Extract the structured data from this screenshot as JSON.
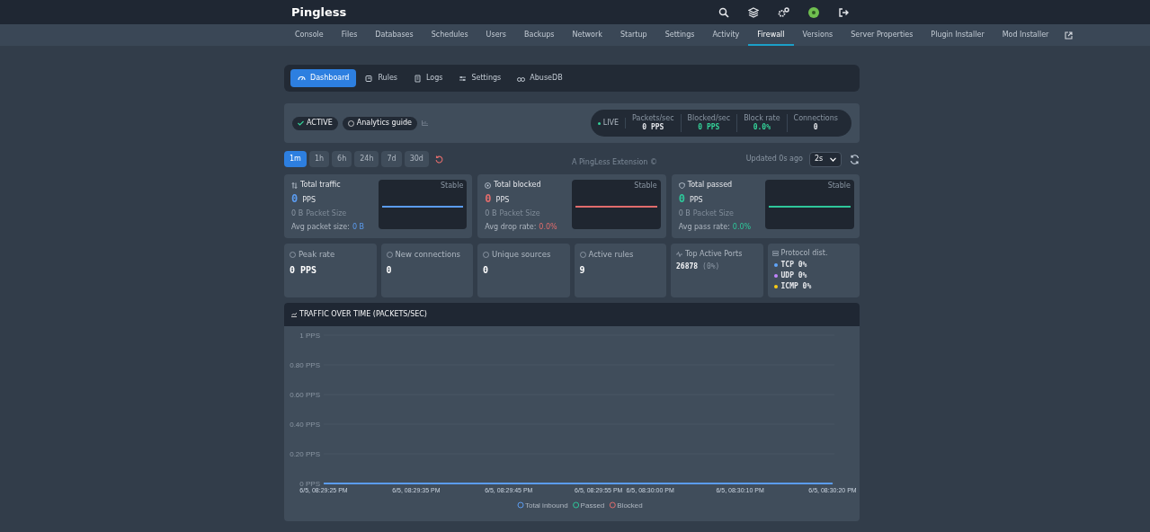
{
  "app": {
    "title": "Pingless"
  },
  "nav_tabs": [
    {
      "label": "Console",
      "selected": false
    },
    {
      "label": "Files",
      "selected": false
    },
    {
      "label": "Databases",
      "selected": false
    },
    {
      "label": "Schedules",
      "selected": false
    },
    {
      "label": "Users",
      "selected": false
    },
    {
      "label": "Backups",
      "selected": false
    },
    {
      "label": "Network",
      "selected": false
    },
    {
      "label": "Startup",
      "selected": false
    },
    {
      "label": "Settings",
      "selected": false
    },
    {
      "label": "Activity",
      "selected": false
    },
    {
      "label": "Firewall",
      "selected": true
    },
    {
      "label": "Versions",
      "selected": false
    },
    {
      "label": "Server Properties",
      "selected": false
    },
    {
      "label": "Plugin Installer",
      "selected": false
    },
    {
      "label": "Mod Installer",
      "selected": false
    }
  ],
  "sub_tabs": [
    {
      "label": "Dashboard",
      "selected": true
    },
    {
      "label": "Rules",
      "selected": false
    },
    {
      "label": "Logs",
      "selected": false
    },
    {
      "label": "Settings",
      "selected": false
    },
    {
      "label": "AbuseDB",
      "selected": false
    }
  ],
  "status": {
    "badge": "ACTIVE",
    "guide": "Analytics guide",
    "live": "LIVE",
    "stats": [
      {
        "label": "Packets/sec",
        "value": "0 PPS",
        "color": "#e5e7eb"
      },
      {
        "label": "Blocked/sec",
        "value": "0 PPS",
        "color": "#34d399"
      },
      {
        "label": "Block rate",
        "value": "0.0%",
        "color": "#34d399"
      },
      {
        "label": "Connections",
        "value": "0",
        "color": "#e5e7eb"
      }
    ]
  },
  "ranges": [
    {
      "label": "1m",
      "selected": true
    },
    {
      "label": "1h",
      "selected": false
    },
    {
      "label": "6h",
      "selected": false
    },
    {
      "label": "24h",
      "selected": false
    },
    {
      "label": "7d",
      "selected": false
    },
    {
      "label": "30d",
      "selected": false
    }
  ],
  "footer_note": "A PingLess Extension ©",
  "updated": "Updated 0s ago",
  "interval": "2s",
  "totals": [
    {
      "title": "Total traffic",
      "value": "0",
      "unit": "PPS",
      "size": "0 B",
      "size_label": "Packet Size",
      "avg_label": "Avg packet size:",
      "avg": "0 B",
      "trend": "Stable",
      "color": "#5b9cf0"
    },
    {
      "title": "Total blocked",
      "value": "0",
      "unit": "PPS",
      "size": "0 B",
      "size_label": "Packet Size",
      "avg_label": "Avg drop rate:",
      "avg": "0.0%",
      "trend": "Stable",
      "color": "#e06c6c"
    },
    {
      "title": "Total passed",
      "value": "0",
      "unit": "PPS",
      "size": "0 B",
      "size_label": "Packet Size",
      "avg_label": "Avg pass rate:",
      "avg": "0.0%",
      "trend": "Stable",
      "color": "#2ec79a"
    }
  ],
  "metrics": [
    {
      "title": "Peak rate",
      "value": "0 PPS"
    },
    {
      "title": "New connections",
      "value": "0"
    },
    {
      "title": "Unique sources",
      "value": "0"
    },
    {
      "title": "Active rules",
      "value": "9"
    }
  ],
  "top_ports": {
    "title": "Top Active Ports",
    "port": "26878",
    "share": "(0%)"
  },
  "protocols": {
    "title": "Protocol dist.",
    "items": [
      {
        "label": "TCP 0%",
        "color": "#60a5fa"
      },
      {
        "label": "UDP 0%",
        "color": "#c084fc"
      },
      {
        "label": "ICMP 0%",
        "color": "#facc15"
      }
    ]
  },
  "traffic": {
    "title": "TRAFFIC OVER TIME (PACKETS/SEC)",
    "chart_data": {
      "type": "line",
      "categories": [
        "6/5, 08:29:25 PM",
        null,
        "6/5, 08:29:35 PM",
        null,
        "6/5, 08:29:45 PM",
        null,
        "6/5, 08:29:55 PM",
        "6/5, 08:30:00 PM",
        null,
        "6/5, 08:30:10 PM",
        null,
        "6/5, 08:30:20 PM"
      ],
      "ylim": [
        0,
        1
      ],
      "legend": "bottom",
      "yticks": [
        {
          "value": 0,
          "label": "0 PPS"
        },
        {
          "value": 0.2,
          "label": "0.20 PPS"
        },
        {
          "value": 0.4,
          "label": "0.40 PPS"
        },
        {
          "value": 0.6,
          "label": "0.60 PPS"
        },
        {
          "value": 0.8,
          "label": "0.80 PPS"
        },
        {
          "value": 1,
          "label": "1 PPS"
        }
      ],
      "series": [
        {
          "name": "Total inbound",
          "color": "#5b9cf0",
          "values": [
            0,
            0,
            0,
            0,
            0,
            0,
            0,
            0,
            0,
            0,
            0,
            0
          ]
        },
        {
          "name": "Passed",
          "color": "#2ec79a",
          "values": [
            null,
            null,
            null,
            null,
            null,
            null,
            null,
            null,
            null,
            null,
            null,
            null
          ]
        },
        {
          "name": "Blocked",
          "color": "#e06c6c",
          "values": [
            null,
            null,
            null,
            null,
            null,
            null,
            null,
            null,
            null,
            null,
            null,
            null
          ]
        }
      ]
    }
  }
}
